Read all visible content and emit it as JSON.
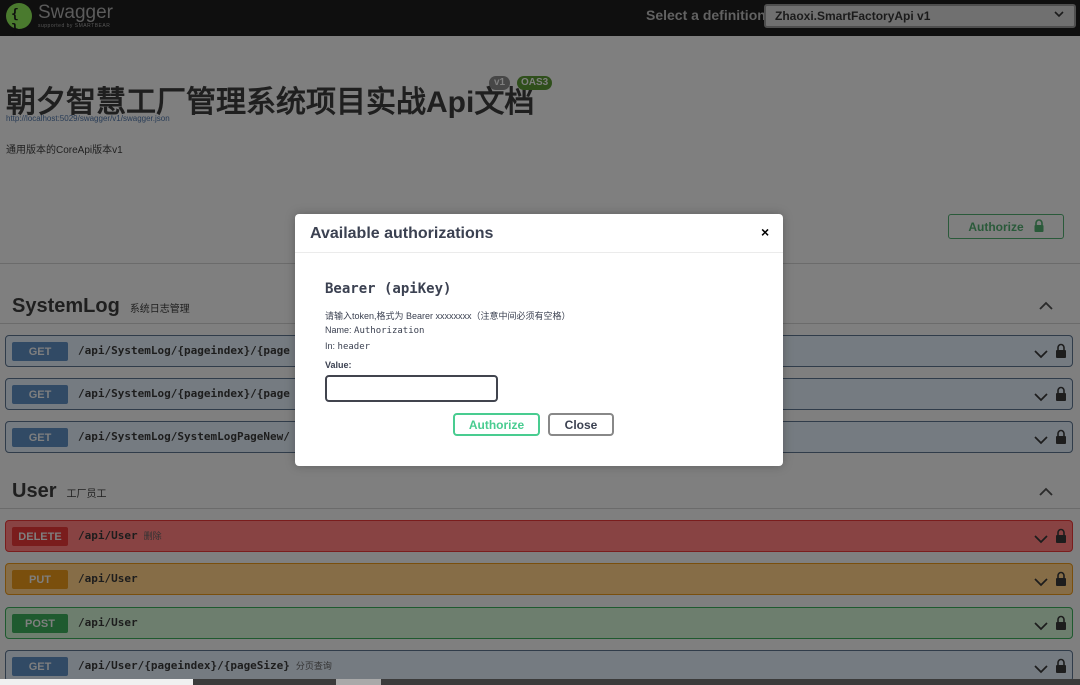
{
  "topbar": {
    "logo_name": "Swagger",
    "logo_sub": "supported by SMARTBEAR",
    "select_label": "Select a definition",
    "select_value": "Zhaoxi.SmartFactoryApi v1"
  },
  "info": {
    "title": "朝夕智慧工厂管理系统项目实战Api文档",
    "version_badge": "v1",
    "oas_badge": "OAS3",
    "url": "http://localhost:5029/swagger/v1/swagger.json",
    "description": "通用版本的CoreApi版本v1",
    "authorize_label": "Authorize"
  },
  "groups": [
    {
      "name": "SystemLog",
      "description": "系统日志管理",
      "operations": [
        {
          "method": "GET",
          "path": "/api/SystemLog/{pageindex}/{page",
          "summary": ""
        },
        {
          "method": "GET",
          "path": "/api/SystemLog/{pageindex}/{page",
          "summary": ""
        },
        {
          "method": "GET",
          "path": "/api/SystemLog/SystemLogPageNew/",
          "summary": ""
        }
      ]
    },
    {
      "name": "User",
      "description": "工厂员工",
      "operations": [
        {
          "method": "DELETE",
          "path": "/api/User",
          "summary": "删除"
        },
        {
          "method": "PUT",
          "path": "/api/User",
          "summary": ""
        },
        {
          "method": "POST",
          "path": "/api/User",
          "summary": ""
        },
        {
          "method": "GET",
          "path": "/api/User/{pageindex}/{pageSize}",
          "summary": "分页查询"
        }
      ]
    }
  ],
  "modal": {
    "title": "Available authorizations",
    "close_glyph": "×",
    "scheme_title": "Bearer (apiKey)",
    "description": "请输入token,格式为 Bearer xxxxxxxx（注意中间必须有空格）",
    "name_label": "Name:",
    "name_value": "Authorization",
    "in_label": "In:",
    "in_value": "header",
    "value_label": "Value:",
    "value_input": "",
    "authorize_button": "Authorize",
    "close_button": "Close"
  },
  "colors": {
    "accent_green": "#49cc90",
    "get_blue": "#61affe",
    "delete_red": "#f93e3e",
    "put_orange": "#fca130",
    "post_green": "#49cc90"
  },
  "icons": {
    "authorize_button": "lock-icon",
    "operation_expand": "chevron-down-icon",
    "operation_lock": "lock-icon",
    "group_collapse": "chevron-up-icon",
    "select_arrow": "chevron-down-icon",
    "modal_close": "close-icon"
  }
}
